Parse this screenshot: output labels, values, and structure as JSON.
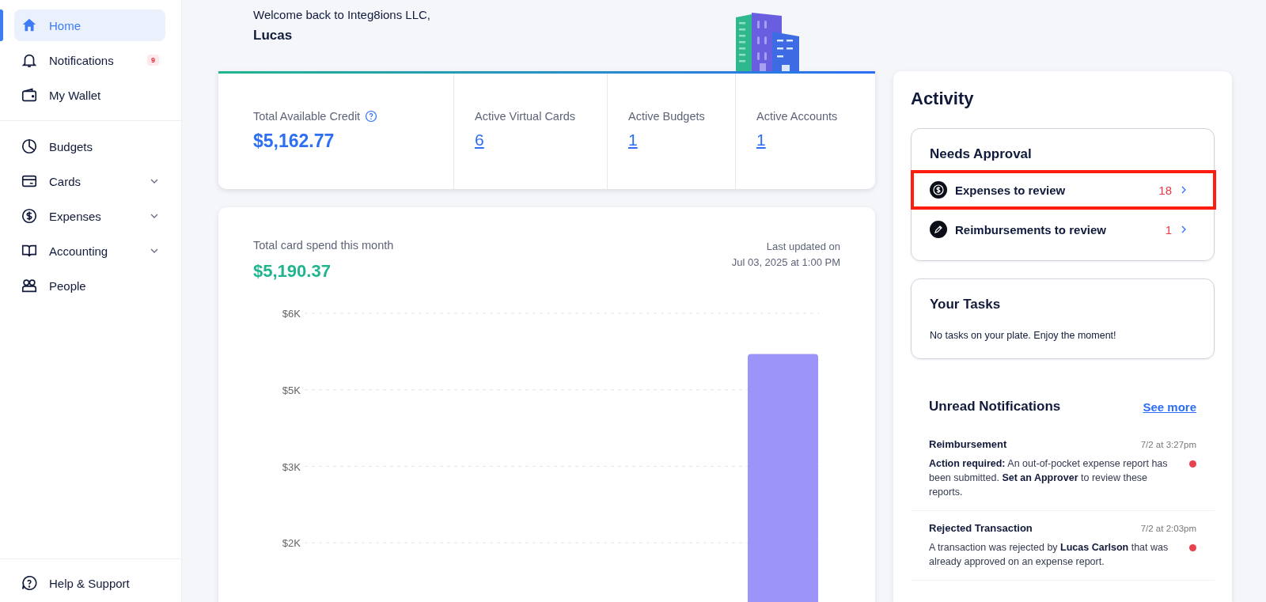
{
  "sidebar": {
    "items": [
      {
        "label": "Home",
        "selected": true,
        "expandable": false
      },
      {
        "label": "Notifications",
        "selected": false,
        "expandable": false,
        "badge": "9"
      },
      {
        "label": "My Wallet",
        "selected": false,
        "expandable": false
      },
      {
        "label": "Budgets",
        "selected": false,
        "expandable": false
      },
      {
        "label": "Cards",
        "selected": false,
        "expandable": true
      },
      {
        "label": "Expenses",
        "selected": false,
        "expandable": true
      },
      {
        "label": "Accounting",
        "selected": false,
        "expandable": true
      },
      {
        "label": "People",
        "selected": false,
        "expandable": false
      }
    ],
    "footer": {
      "label": "Help & Support"
    }
  },
  "welcome": {
    "greeting": "Welcome back to Integ8ions LLC,",
    "name": "Lucas"
  },
  "summary": {
    "credit": {
      "label": "Total Available Credit",
      "value": "$5,162.77"
    },
    "stats": [
      {
        "label": "Active Virtual Cards",
        "value": "6"
      },
      {
        "label": "Active Budgets",
        "value": "1"
      },
      {
        "label": "Active Accounts",
        "value": "1"
      }
    ]
  },
  "spend": {
    "label": "Total card spend this month",
    "value": "$5,190.37",
    "updated": "Last updated on",
    "updated_time": "Jul 03, 2025 at 1:00 PM",
    "chart_data": {
      "type": "bar",
      "grid": true,
      "values": [
        5200
      ],
      "ylim": [
        0,
        6000
      ],
      "yticks": [
        {
          "value": 6000,
          "label": "$6K"
        },
        {
          "value": 4500,
          "label": "$5K"
        },
        {
          "value": 3000,
          "label": "$3K"
        },
        {
          "value": 1500,
          "label": "$2K"
        }
      ]
    }
  },
  "activity": {
    "title": "Activity",
    "approval": {
      "title": "Needs Approval",
      "items": [
        {
          "label": "Expenses to review",
          "count": "18",
          "highlighted": true
        },
        {
          "label": "Reimbursements to review",
          "count": "1",
          "highlighted": false
        }
      ]
    },
    "tasks": {
      "title": "Your Tasks",
      "message": "No tasks on your plate. Enjoy the moment!"
    },
    "notifications": {
      "title": "Unread Notifications",
      "link": "See more",
      "items": [
        {
          "title": "Reimbursement",
          "time": "7/2 at 3:27pm",
          "text": "**Action required:** An out-of-pocket expense report has been submitted. **Set an Approver** to review these reports.",
          "unread": true
        },
        {
          "title": "Rejected Transaction",
          "time": "7/2 at 2:03pm",
          "text": "A transaction was rejected by **Lucas Carlson** that was already approved on an expense report.",
          "unread": true
        }
      ]
    }
  }
}
